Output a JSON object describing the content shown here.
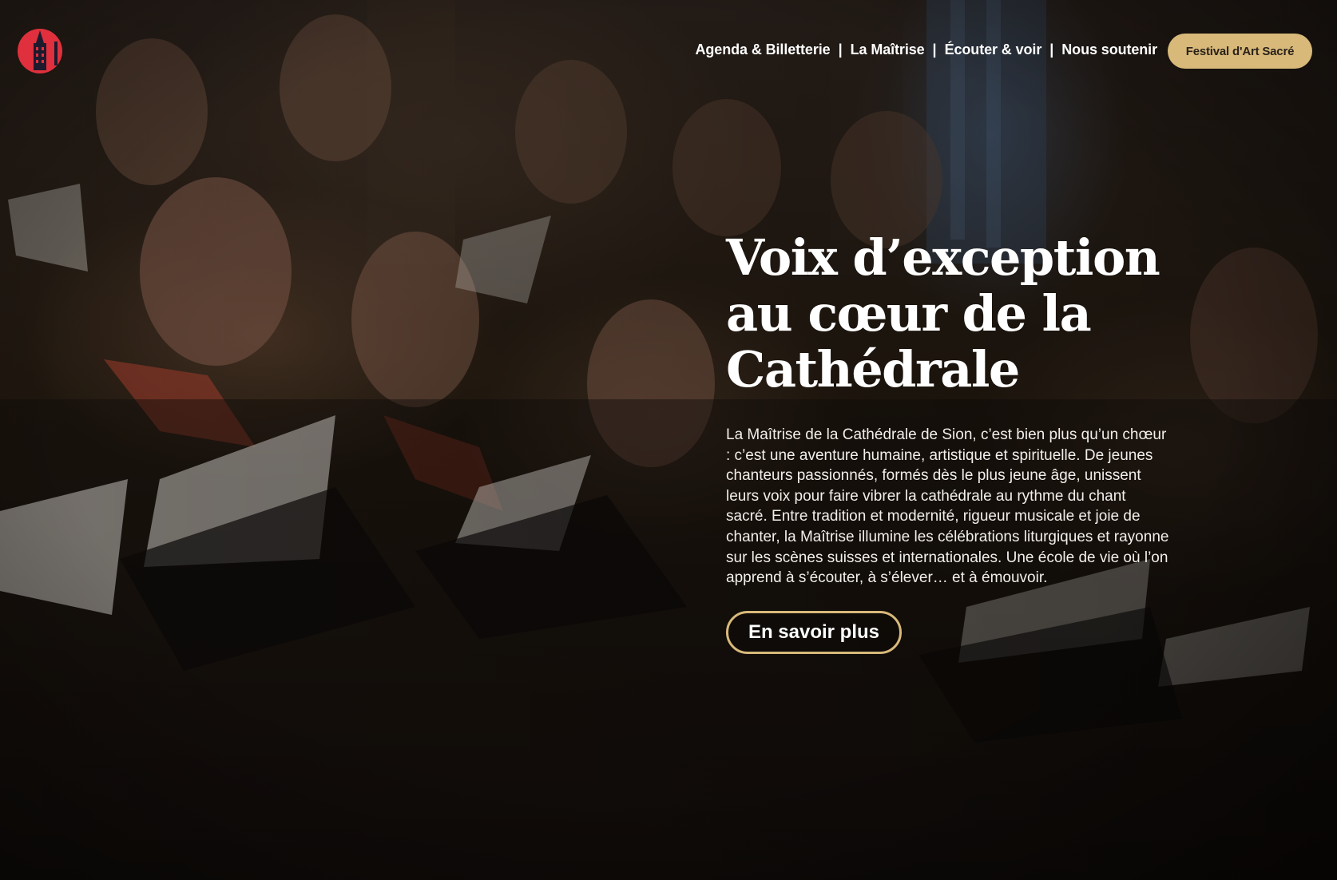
{
  "brand": {
    "logo_icon": "cathedral-tower-logo",
    "logo_color": "#e0303d"
  },
  "nav": {
    "items": [
      {
        "label": "Agenda & Billetterie"
      },
      {
        "label": "La Maîtrise"
      },
      {
        "label": "Écouter & voir"
      },
      {
        "label": "Nous soutenir"
      }
    ],
    "separator": "|",
    "festival_label": "Festival d'Art Sacré"
  },
  "hero": {
    "title_line1": "Voix d’exception",
    "title_line2": "au cœur de la",
    "title_line3": "Cathédrale",
    "description": "La Maîtrise de la Cathédrale de Sion, c’est bien plus qu’un chœur : c’est une aventure humaine, artistique et spirituelle. De jeunes chanteurs passionnés, formés dès le plus jeune âge, unissent leurs voix pour faire vibrer la cathédrale au rythme du chant sacré. Entre tradition et modernité, rigueur musicale et joie de chanter, la Maîtrise illumine les célébrations liturgiques et rayonne sur les scènes suisses et internationales. Une école de vie où l’on apprend à s’écouter, à s’élever… et à émouvoir.",
    "cta_label": "En savoir plus",
    "background": "choir-singing-photo"
  },
  "colors": {
    "accent": "#d8b97a",
    "logo": "#e0303d",
    "text": "#ffffff"
  }
}
